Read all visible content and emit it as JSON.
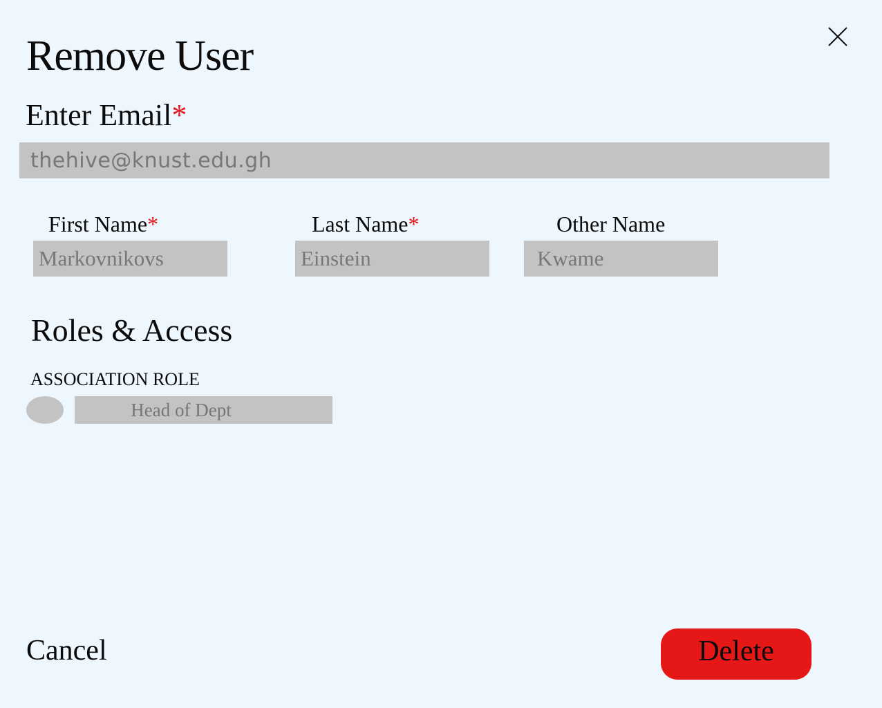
{
  "dialog": {
    "title": "Remove User",
    "close_icon": "close-icon"
  },
  "email": {
    "label": "Enter Email",
    "required_mark": "*",
    "placeholder": "thehive@knust.edu.gh"
  },
  "names": {
    "first": {
      "label": "First Name",
      "required_mark": "*",
      "value": "Markovnikovs"
    },
    "last": {
      "label": "Last Name",
      "required_mark": "*",
      "value": "Einstein"
    },
    "other": {
      "label": "Other Name",
      "value": "Kwame"
    }
  },
  "roles": {
    "heading": "Roles & Access",
    "association_label": "ASSOCIATION ROLE",
    "selected_role": "Head of Dept"
  },
  "actions": {
    "cancel_label": "Cancel",
    "delete_label": "Delete"
  },
  "colors": {
    "background": "#eff7fe",
    "field": "#c3c3c3",
    "field_text": "#777777",
    "required": "#e0161a",
    "danger": "#e61717"
  }
}
